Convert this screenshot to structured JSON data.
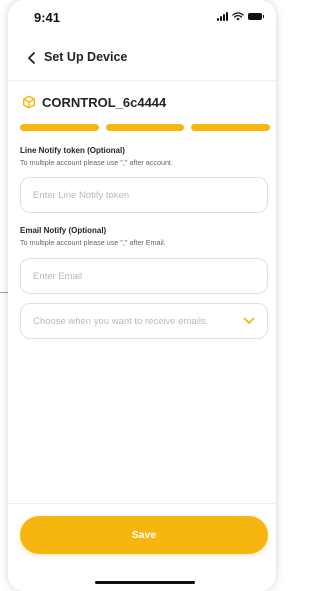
{
  "status_bar": {
    "time": "9:41",
    "icons": [
      "cellular-signal-icon",
      "wifi-icon",
      "battery-icon"
    ]
  },
  "header": {
    "back_icon": "chevron-left-icon",
    "title": "Set Up Device"
  },
  "device": {
    "icon": "cube-icon",
    "name": "CORNTROL_6c4444"
  },
  "progress": {
    "steps_total": 3,
    "steps_completed": 3,
    "color": "#f6b60f"
  },
  "line_notify": {
    "label": "Line Notify token (Optional)",
    "hint": "To multiple account please use \",\" after account.",
    "value": "",
    "placeholder": "Enter Line Notify token"
  },
  "email_notify": {
    "label": "Email Notify (Optional)",
    "hint": "To multiple account please use \",\" after Email.",
    "value": "",
    "placeholder": "Enter Email",
    "schedule_placeholder": "Choose when you want to receive emails.",
    "dropdown_icon": "chevron-down-icon"
  },
  "footer": {
    "save_label": "Save"
  },
  "colors": {
    "accent": "#f6b60f",
    "text": "#1f2328",
    "hint_text": "#5f6670",
    "placeholder": "#b5bac1",
    "border": "#dcdfe3"
  }
}
